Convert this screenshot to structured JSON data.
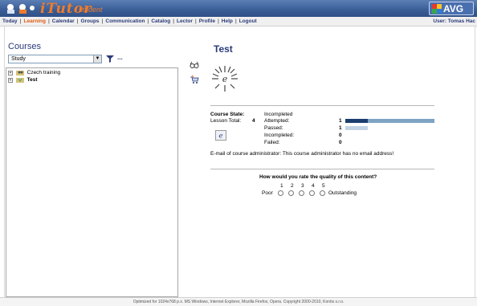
{
  "header": {
    "brand": "iTutor",
    "brand_sub": "student",
    "avg_label": "AVG"
  },
  "nav": {
    "items": [
      "Today",
      "Learning",
      "Calendar",
      "Groups",
      "Communication",
      "Catalog",
      "Lector",
      "Profile",
      "Help",
      "Logout"
    ],
    "active": "Learning",
    "user_label": "User: Tomas Hac"
  },
  "courses": {
    "title": "Courses",
    "select_value": "Study",
    "more_label": "...",
    "tree": [
      {
        "label": "Czech training",
        "bold": false
      },
      {
        "label": "Test",
        "bold": true
      }
    ]
  },
  "content": {
    "title": "Test",
    "course_state_label": "Course State:",
    "course_state_value": "Incompleted",
    "lesson_total_label": "Lesson Total:",
    "lesson_total_value": "4",
    "stats": [
      {
        "label": "Attempted:",
        "value": "1"
      },
      {
        "label": "Passed:",
        "value": "1"
      },
      {
        "label": "Incompleted:",
        "value": "0"
      },
      {
        "label": "Failed:",
        "value": "0"
      }
    ],
    "email_line": "E-mail of course administrator: This course administrator has no email address!",
    "rating": {
      "question": "How would you rate the quality of this content?",
      "numbers": [
        "1",
        "2",
        "3",
        "4",
        "5"
      ],
      "low_label": "Poor",
      "high_label": "Outstanding"
    }
  },
  "footer": {
    "text": "Optimized for 1024x768 p.x. MS Windows, Internet Explorer, Mozilla Firefox, Opera. Copyright 2000-2010, Kontis s.r.o."
  },
  "colors": {
    "header_blue": "#3c5f98",
    "nav_text": "#2b3b7a",
    "active_nav": "#e05a10",
    "bar_dark": "#1c3d6e",
    "bar_light": "#7ea3c4"
  }
}
